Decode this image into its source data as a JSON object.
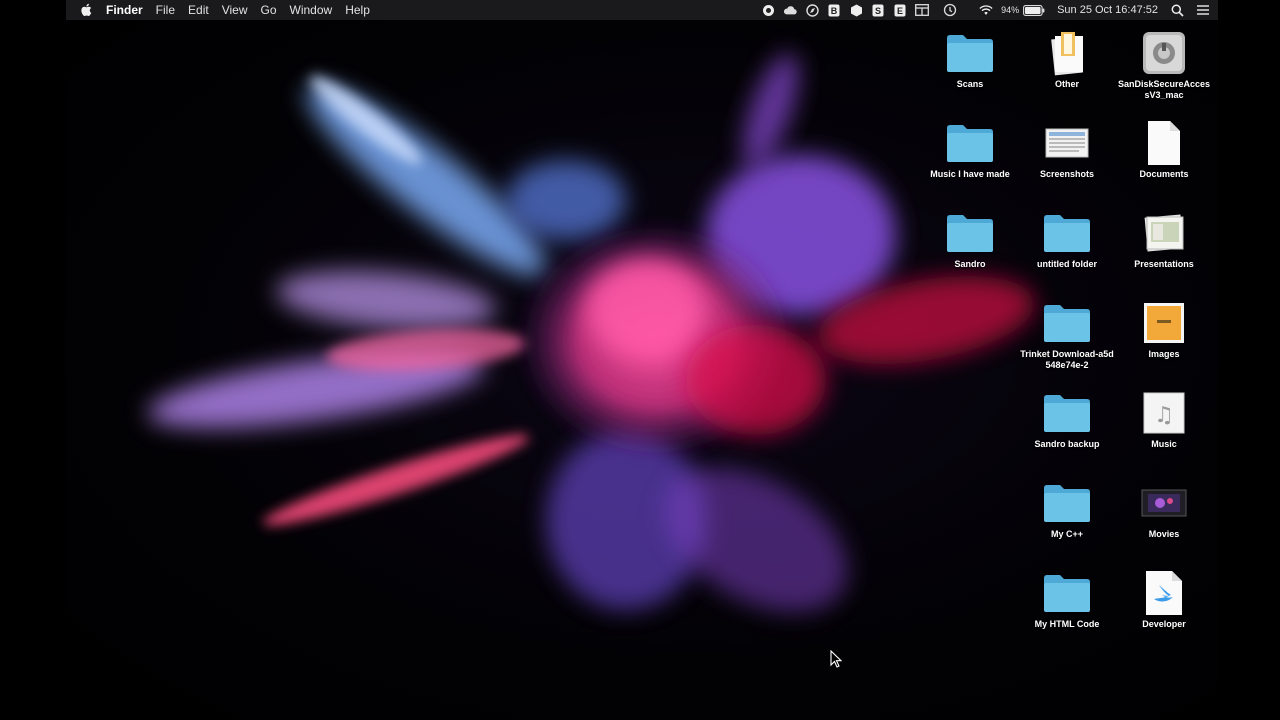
{
  "menubar": {
    "app_name": "Finder",
    "menus": [
      "File",
      "Edit",
      "View",
      "Go",
      "Window",
      "Help"
    ],
    "status": {
      "battery_percent": "94%",
      "clock": "Sun 25 Oct  16:47:52"
    },
    "status_icons": [
      "record-icon",
      "cloud-icon",
      "compass-icon",
      "b-app-icon",
      "hex-icon",
      "s-app-icon",
      "e-app-icon",
      "window-icon",
      "time-machine-icon",
      "wifi-icon",
      "battery-icon",
      "search-icon",
      "list-icon"
    ]
  },
  "desktop": {
    "icons": [
      {
        "label": "Scans",
        "type": "folder"
      },
      {
        "label": "Other",
        "type": "doc-stack"
      },
      {
        "label": "SanDiskSecureAccessV3_mac",
        "type": "disk"
      },
      {
        "label": "Music I have made",
        "type": "folder"
      },
      {
        "label": "Screenshots",
        "type": "screenshot"
      },
      {
        "label": "Documents",
        "type": "blank-doc"
      },
      {
        "label": "Sandro",
        "type": "folder"
      },
      {
        "label": "untitled folder",
        "type": "folder"
      },
      {
        "label": "Presentations",
        "type": "presentation"
      },
      {
        "label": "Trinket Download-a5d548e74e-2",
        "type": "folder"
      },
      {
        "label": "Images",
        "type": "image-doc"
      },
      {
        "label": "Sandro backup",
        "type": "folder"
      },
      {
        "label": "Music",
        "type": "music-doc"
      },
      {
        "label": "My C++",
        "type": "folder"
      },
      {
        "label": "Movies",
        "type": "movie-doc"
      },
      {
        "label": "My HTML Code",
        "type": "folder"
      },
      {
        "label": "Developer",
        "type": "swift-doc"
      }
    ]
  },
  "colors": {
    "folder": "#6cc3e8",
    "folder_dark": "#4fa9d6",
    "menubar": "#1c1c1e",
    "wallpaper_pink": "#ff3c8c",
    "wallpaper_purple": "#9a5cff",
    "wallpaper_blue": "#6aa6ff"
  }
}
